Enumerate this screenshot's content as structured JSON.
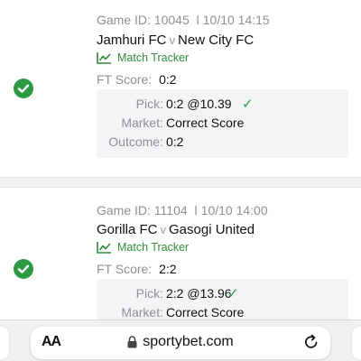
{
  "bets": [
    {
      "game_id_label": "Game ID:",
      "game_id": "10045",
      "separator": "l",
      "datetime": "10/10 14:15",
      "home_team": "Jamhuri FC",
      "vs": "v",
      "away_team": "New City FC",
      "tracker_label": "Match Tracker",
      "ft_score_label": "FT Score:",
      "ft_score": "0:2",
      "pick_label": "Pick:",
      "pick": "0:2 @10.39",
      "market_label": "Market:",
      "market": "Correct Score",
      "outcome_label": "Outcome:",
      "outcome": "0:2",
      "status": "won"
    },
    {
      "game_id_label": "Game ID:",
      "game_id": "11104",
      "separator": "l",
      "datetime": "10/10 14:00",
      "home_team": "Gorilla FC",
      "vs": "v",
      "away_team": "Gasogi United",
      "tracker_label": "Match Tracker",
      "ft_score_label": "FT Score:",
      "ft_score": "2:2",
      "pick_label": "Pick:",
      "pick": "2:2 @13.96",
      "market_label": "Market:",
      "market": "Correct Score",
      "status": "won"
    }
  ],
  "icons": {
    "status": "check-circle-icon",
    "tracker": "chart-line-icon",
    "pick_check": "checkmark-icon",
    "lock": "lock-icon",
    "reload": "reload-icon"
  },
  "colors": {
    "won_green": "#2e9a43",
    "tracker_green": "#2e8b3a",
    "label_gray": "#8e9096",
    "box_bg": "#f3f4f6"
  },
  "browser": {
    "text_size_button": "AA",
    "url": "sportybet.com"
  }
}
